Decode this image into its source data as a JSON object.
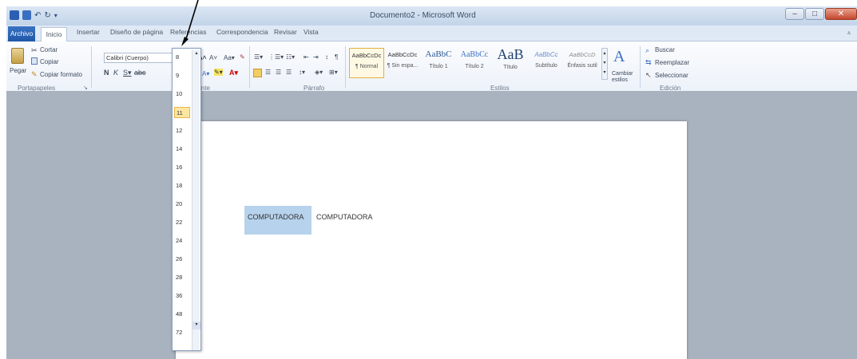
{
  "window": {
    "title": "Documento2 - Microsoft Word"
  },
  "tabs": [
    "Archivo",
    "Inicio",
    "Insertar",
    "Diseño de página",
    "Referencias",
    "Correspondencia",
    "Revisar",
    "Vista"
  ],
  "clipboard": {
    "paste": "Pegar",
    "cut": "Cortar",
    "copy": "Copiar",
    "format_painter": "Copiar formato",
    "group": "Portapapeles"
  },
  "font": {
    "name": "Calibri (Cuerpo)",
    "size": "11",
    "group": "Fuente"
  },
  "paragraph": {
    "group": "Párrafo"
  },
  "styles": {
    "group": "Estilos",
    "items": [
      {
        "preview": "AaBbCcDc",
        "name": "¶ Normal"
      },
      {
        "preview": "AaBbCcDc",
        "name": "¶ Sin espa..."
      },
      {
        "preview": "AaBbC",
        "name": "Título 1"
      },
      {
        "preview": "AaBbCc",
        "name": "Título 2"
      },
      {
        "preview": "AaB",
        "name": "Título"
      },
      {
        "preview": "AaBbCc",
        "name": "Subtítulo"
      },
      {
        "preview": "AaBbCcD",
        "name": "Énfasis sutil"
      }
    ],
    "change": "Cambiar estilos"
  },
  "editing": {
    "group": "Edición",
    "find": "Buscar",
    "replace": "Reemplazar",
    "select": "Seleccionar"
  },
  "document": {
    "word1": "COMPUTADORA",
    "word2": "COMPUTADORA"
  },
  "size_options": [
    "8",
    "9",
    "10",
    "11",
    "12",
    "14",
    "16",
    "18",
    "20",
    "22",
    "24",
    "26",
    "28",
    "36",
    "48",
    "72"
  ],
  "selected_size": "11",
  "colors": {
    "selection": "#b7d2ec",
    "archivo_tab": "#1f58a8",
    "hover_highlight": "#fde7a0"
  }
}
